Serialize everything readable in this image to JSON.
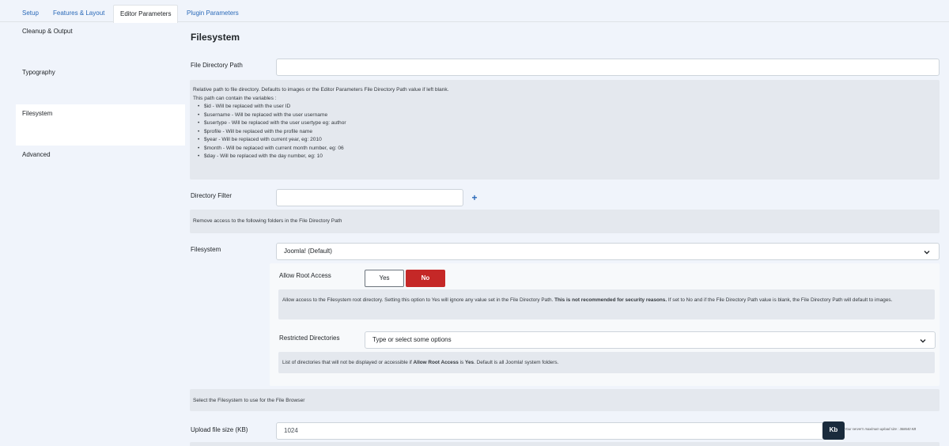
{
  "tabs": [
    {
      "label": "Setup"
    },
    {
      "label": "Features & Layout"
    },
    {
      "label": "Editor Parameters"
    },
    {
      "label": "Plugin Parameters"
    }
  ],
  "sidebar": {
    "items": [
      {
        "label": "Cleanup & Output"
      },
      {
        "label": "Typography"
      },
      {
        "label": "Filesystem"
      },
      {
        "label": "Advanced"
      }
    ]
  },
  "main": {
    "title": "Filesystem",
    "file_dir": {
      "label": "File Directory Path",
      "value": "",
      "desc_intro": "Relative path to file directory. Defaults to images or the Editor Parameters File Directory Path value if left blank.",
      "desc_vars_intro": "This path can contain the variables :",
      "vars": [
        "$id - Will be replaced with the user ID",
        "$username - Will be replaced with the user username",
        "$usertype - Will be replaced with the user usertype eg: author",
        "$profile - Will be replaced with the profile name",
        "$year - Will be replaced with current year, eg: 2010",
        "$month - Will be replaced with current month number, eg: 06",
        "$day - Will be replaced with the day number, eg: 10"
      ]
    },
    "dir_filter": {
      "label": "Directory Filter",
      "value": "",
      "desc": "Remove access to the following folders in the File Directory Path"
    },
    "filesystem": {
      "label": "Filesystem",
      "selected": "Joomla! (Default)",
      "allow_root": {
        "label": "Allow Root Access",
        "yes": "Yes",
        "no": "No",
        "desc_a": "Allow access to the Filesystem root directory. Setting this option to Yes will ignore any value set in the File Directory Path.",
        "desc_strong": "This is not recommended for security reasons.",
        "desc_b": "If set to No and if the File Directory Path value is blank, the File Directory Path will default to images."
      },
      "restricted": {
        "label": "Restricted Directories",
        "placeholder": "Type or select some options",
        "desc_a": "List of directories that will not be displayed or accessible if",
        "desc_strong": "Allow Root Access",
        "desc_b": "is",
        "desc_strong2": "Yes",
        "desc_c": ". Default is all Joomla! system folders."
      },
      "desc": "Select the Filesystem to use for the File Browser"
    },
    "upload": {
      "label": "Upload file size (KB)",
      "value": "1024",
      "unit": "Kb",
      "hint": "Your server's maximum upload size : 368640 KB"
    }
  }
}
